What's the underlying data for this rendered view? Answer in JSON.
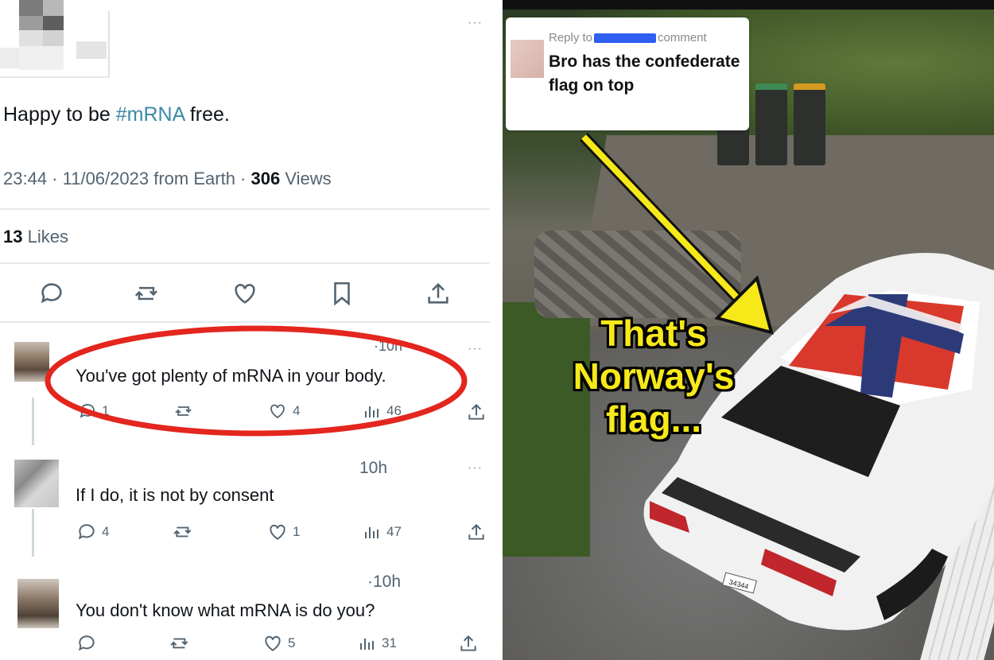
{
  "tweet": {
    "text_before": "Happy to be ",
    "hashtag": "#mRNA",
    "text_after": " free.",
    "time": "23:44",
    "date": "11/06/2023",
    "source": "from Earth",
    "views_count": "306",
    "views_label": "Views",
    "likes_count": "13",
    "likes_label": "Likes",
    "more": "···"
  },
  "replies": [
    {
      "text": "You've got plenty of mRNA in your body.",
      "time": "10h",
      "reply_count": "1",
      "like_count": "4",
      "view_count": "46"
    },
    {
      "text": "If I do, it is not by consent",
      "time": "10h",
      "reply_count": "4",
      "like_count": "1",
      "view_count": "47"
    },
    {
      "text": "You don't know what mRNA is do you?",
      "time": "10h",
      "reply_count": "",
      "like_count": "5",
      "view_count": "31"
    }
  ],
  "highlight_color": "#e3261e",
  "comment_bubble": {
    "reply_to": "Reply to",
    "reply_suffix": "comment",
    "message": "Bro has the confederate flag on top",
    "redaction_color": "#2f5ef0"
  },
  "caption": {
    "line1": "That's",
    "line2": "Norway's",
    "line3": "flag...",
    "color": "#f7e81a"
  },
  "plate": "34344"
}
